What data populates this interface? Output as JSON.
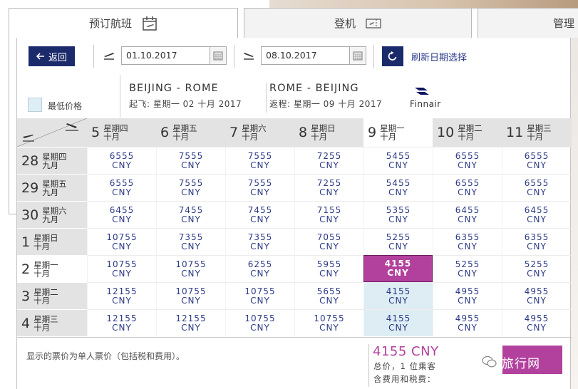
{
  "tabs": {
    "book": "预订航班",
    "checkin": "登机",
    "manage": "管理"
  },
  "toolbar": {
    "back_label": "返回",
    "depart_date": "01.10.2017",
    "return_date": "08.10.2017",
    "refresh_label": "刷新日期选择"
  },
  "legend": {
    "lowest_price": "最低价格"
  },
  "outbound": {
    "route": "BEIJING - ROME",
    "detail": "起飞: 星期一 02 十月 2017"
  },
  "inbound": {
    "route": "ROME - BEIJING",
    "detail": "返程: 星期一 09 十月 2017"
  },
  "airline": {
    "name": "Finnair"
  },
  "grid": {
    "columns": [
      {
        "num": "5",
        "weekday": "星期四",
        "month": "十月"
      },
      {
        "num": "6",
        "weekday": "星期五",
        "month": "十月"
      },
      {
        "num": "7",
        "weekday": "星期六",
        "month": "十月"
      },
      {
        "num": "8",
        "weekday": "星期日",
        "month": "十月"
      },
      {
        "num": "9",
        "weekday": "星期一",
        "month": "十月"
      },
      {
        "num": "10",
        "weekday": "星期二",
        "month": "十月"
      },
      {
        "num": "11",
        "weekday": "星期三",
        "month": "十月"
      }
    ],
    "rows": [
      {
        "num": "28",
        "weekday": "星期四",
        "month": "九月",
        "prices": [
          "6555",
          "7555",
          "7555",
          "7255",
          "5455",
          "6555",
          "6555"
        ]
      },
      {
        "num": "29",
        "weekday": "星期五",
        "month": "九月",
        "prices": [
          "6555",
          "7555",
          "7555",
          "7255",
          "5455",
          "6555",
          "6555"
        ]
      },
      {
        "num": "30",
        "weekday": "星期六",
        "month": "九月",
        "prices": [
          "6455",
          "7455",
          "7455",
          "7155",
          "5355",
          "6455",
          "6455"
        ]
      },
      {
        "num": "1",
        "weekday": "星期日",
        "month": "十月",
        "prices": [
          "10755",
          "7355",
          "7355",
          "7055",
          "5255",
          "6355",
          "6355"
        ]
      },
      {
        "num": "2",
        "weekday": "星期一",
        "month": "十月",
        "prices": [
          "10755",
          "10755",
          "6255",
          "5955",
          "4155",
          "5255",
          "5255"
        ]
      },
      {
        "num": "3",
        "weekday": "星期二",
        "month": "十月",
        "prices": [
          "12155",
          "10755",
          "10755",
          "5655",
          "4155",
          "4955",
          "4955"
        ]
      },
      {
        "num": "4",
        "weekday": "星期三",
        "month": "十月",
        "prices": [
          "12155",
          "12155",
          "10755",
          "10755",
          "4155",
          "4955",
          "4955"
        ]
      }
    ],
    "currency": "CNY",
    "selected_row": 4,
    "selected_col": 4
  },
  "footer": {
    "note": "显示的票价为单人票价（包括税和费用）。",
    "total_price": "4155 CNY",
    "total_line1": "总价，1 位乘客",
    "total_line2": "含费用和税费："
  },
  "watermark": {
    "text": "旅行网"
  },
  "colors": {
    "brand_navy": "#1b2a6b",
    "selected_magenta": "#b2419d",
    "lowest_price_highlight": "#deedf3",
    "price_text": "#2c3a86"
  }
}
